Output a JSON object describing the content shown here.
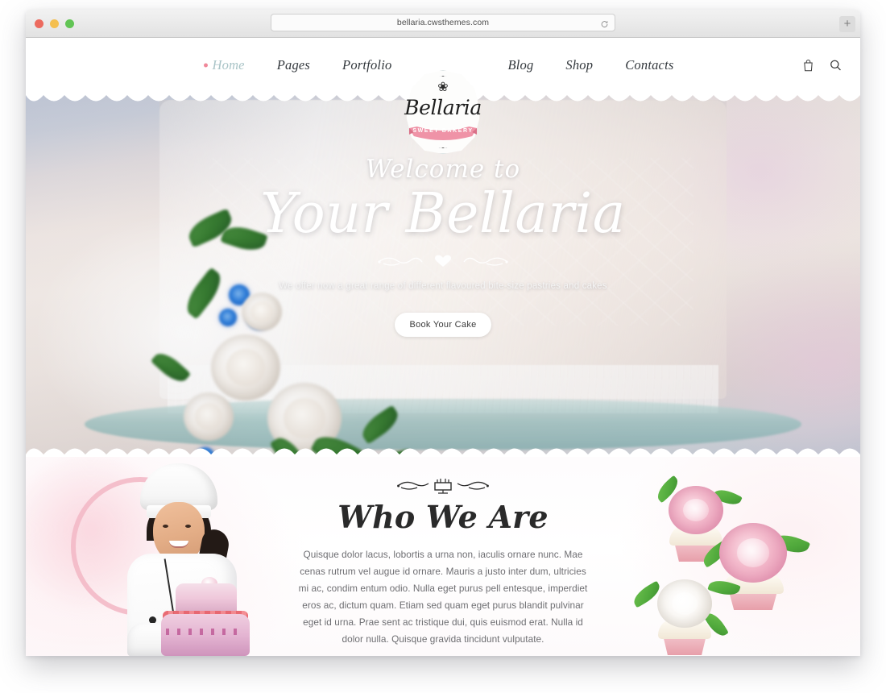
{
  "browser": {
    "url": "bellaria.cwsthemes.com",
    "reload_icon": "reload-icon",
    "new_tab_label": "+",
    "traffic_lights": [
      "close",
      "minimize",
      "maximize"
    ]
  },
  "header": {
    "nav_left": [
      {
        "label": "Home",
        "active": true
      },
      {
        "label": "Pages",
        "active": false
      },
      {
        "label": "Portfolio",
        "active": false
      }
    ],
    "nav_right": [
      {
        "label": "Blog",
        "active": false
      },
      {
        "label": "Shop",
        "active": false
      },
      {
        "label": "Contacts",
        "active": false
      }
    ],
    "tools": [
      {
        "name": "shopping-bag-icon"
      },
      {
        "name": "search-icon"
      }
    ]
  },
  "logo": {
    "name": "Bellaria",
    "ribbon": "SWEET BAKERY",
    "swirl": "❀"
  },
  "hero": {
    "eyebrow": "Welcome to",
    "title": "Your Bellaria",
    "subtitle": "We offer now a great range of different flavoured bite-size pastries and cakes",
    "button": "Book Your Cake"
  },
  "about": {
    "title": "Who We Are",
    "ornament_top": "cake-ornament-icon",
    "ornament_bottom": "flourish-ornament-icon",
    "text": "Quisque dolor lacus, lobortis a urna non, iaculis ornare nunc. Mae cenas rutrum vel augue id ornare. Mauris a justo inter dum, ultricies mi ac, condim entum odio. Nulla eget purus pell entesque, imperdiet eros ac, dictum quam. Etiam sed quam eget purus blandit pulvinar eget id urna. Prae sent ac tristique dui, quis euismod erat. Nulla id dolor nulla. Quisque gravida tincidunt vulputate."
  },
  "colors": {
    "accent_pink": "#f0889a",
    "active_nav": "#a9c4c7",
    "ring_pink": "#f3b9c6",
    "text_dark": "#2a2a2a",
    "text_body": "#6e6e72"
  }
}
